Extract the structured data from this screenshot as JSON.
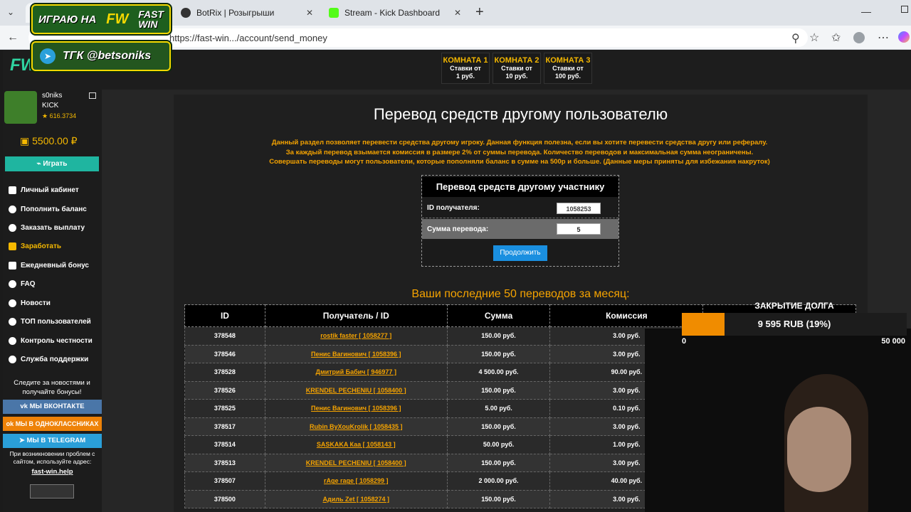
{
  "browser": {
    "tabs": [
      {
        "label": "BotRix | Розыгрыши"
      },
      {
        "label": "Stream - Kick Dashboard"
      }
    ],
    "url": "https://fast-win.../account/send_money"
  },
  "overlay": {
    "line1": "ИГРАЮ НА",
    "logo_top": "FAST",
    "logo_bottom": "WIN",
    "line2": "ТГК @betsoniks"
  },
  "site": {
    "logo": "WIN",
    "rooms": [
      {
        "title": "КОМНАТА 1",
        "sub1": "Ставки от",
        "sub2": "1 руб."
      },
      {
        "title": "КОМНАТА 2",
        "sub1": "Ставки от",
        "sub2": "10 руб."
      },
      {
        "title": "КОМНАТА 3",
        "sub1": "Ставки от",
        "sub2": "100 руб."
      }
    ],
    "user": {
      "name": "s0niks",
      "platform": "KICK",
      "rating": "616.3734",
      "balance": "5500.00 ₽"
    },
    "play_button": "Играть",
    "menu": [
      "Личный кабинет",
      "Пополнить баланс",
      "Заказать выплату",
      "Заработать",
      "Ежедневный бонус",
      "FAQ",
      "Новости",
      "ТОП пользователей",
      "Контроль честности",
      "Служба поддержки"
    ],
    "news_text": "Следите за новостями и получайте бонусы!",
    "social": [
      "МЫ ВКОНТАКТЕ",
      "МЫ В ОДНОКЛАССНИКАХ",
      "МЫ В TELEGRAM"
    ],
    "help_text": "При возникновении проблем с сайтом, используйте адрес:",
    "help_link": "fast-win.help"
  },
  "transfer": {
    "title": "Перевод средств другому пользователю",
    "desc1": "Данный раздел позволяет перевести средства другому игроку. Данная функция полезна, если вы хотите перевести средства другу или рефералу.",
    "desc2": "За каждый перевод взымается комиссия в размере 2% от суммы перевода. Количество переводов и максимальная сумма неограничены.",
    "desc3": "Совершать переводы могут пользователи, которые пополняли баланс в сумме на 500р и больше. (Данные меры приняты для избежания накруток)",
    "form_title": "Перевод средств другому участнику",
    "recipient_label": "ID получателя:",
    "recipient_value": "1058253",
    "amount_label": "Сумма перевода:",
    "amount_value": "5",
    "submit": "Продолжить"
  },
  "history": {
    "title": "Ваши последние 50 переводов за месяц:",
    "columns": [
      "ID",
      "Получатель / ID",
      "Сумма",
      "Комиссия",
      ""
    ],
    "rows": [
      [
        "378548",
        "rostik faster [ 1058277 ]",
        "150.00 руб.",
        "3.00 руб."
      ],
      [
        "378546",
        "Пенис Вагинович [ 1058396 ]",
        "150.00 руб.",
        "3.00 руб."
      ],
      [
        "378528",
        "Дмитрий Бабич [ 946977 ]",
        "4 500.00 руб.",
        "90.00 руб."
      ],
      [
        "378526",
        "KRENDEL PECHENIU [ 1058400 ]",
        "150.00 руб.",
        "3.00 руб."
      ],
      [
        "378525",
        "Пенис Вагинович [ 1058396 ]",
        "5.00 руб.",
        "0.10 руб."
      ],
      [
        "378517",
        "Rubin ByXouKrolik [ 1058435 ]",
        "150.00 руб.",
        "3.00 руб."
      ],
      [
        "378514",
        "SASKAKA Каа [ 1058143 ]",
        "50.00 руб.",
        "1.00 руб."
      ],
      [
        "378513",
        "KRENDEL PECHENIU [ 1058400 ]",
        "150.00 руб.",
        "3.00 руб."
      ],
      [
        "378507",
        "rAge rage [ 1058299 ]",
        "2 000.00 руб.",
        "40.00 руб."
      ],
      [
        "378500",
        "Адиль Zet [ 1058274 ]",
        "150.00 руб.",
        "3.00 руб."
      ]
    ]
  },
  "debt": {
    "title": "ЗАКРЫТИЕ ДОЛГА",
    "value": "9 595 RUB (19%)",
    "progress": 0.19,
    "min": "0",
    "max": "50 000"
  }
}
